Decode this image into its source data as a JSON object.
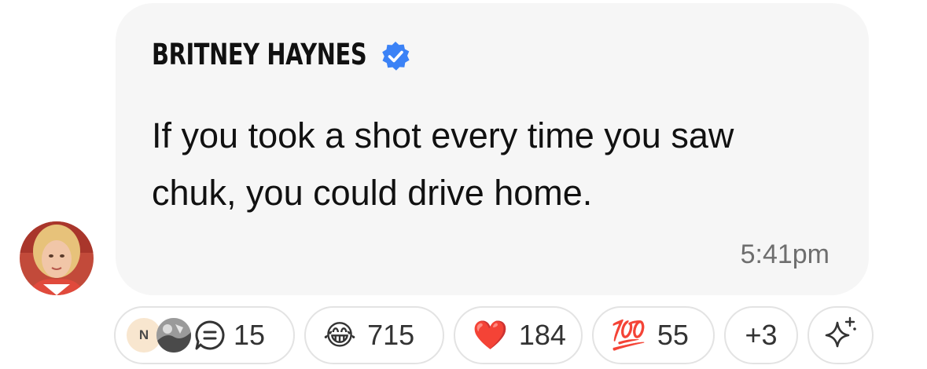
{
  "message": {
    "author": "BRITNEY HAYNES",
    "verified": true,
    "text": "If you took a shot every time you saw chuk, you could drive home.",
    "time": "5:41pm"
  },
  "reactions": {
    "replies": {
      "avatar_initial": "N",
      "count": "15",
      "icon": "chat-bubble-icon"
    },
    "laugh": {
      "emoji": "😂",
      "count": "715"
    },
    "heart": {
      "emoji": "❤️",
      "count": "184"
    },
    "hundred": {
      "emoji": "💯",
      "count": "55"
    },
    "more": {
      "label": "+3"
    },
    "add": {
      "icon": "sparkle-icon"
    }
  },
  "colors": {
    "bubble_bg": "#f6f6f6",
    "verified_blue": "#3b82f6",
    "timestamp": "#6e6e6e",
    "pill_border": "#e3e3e3"
  }
}
